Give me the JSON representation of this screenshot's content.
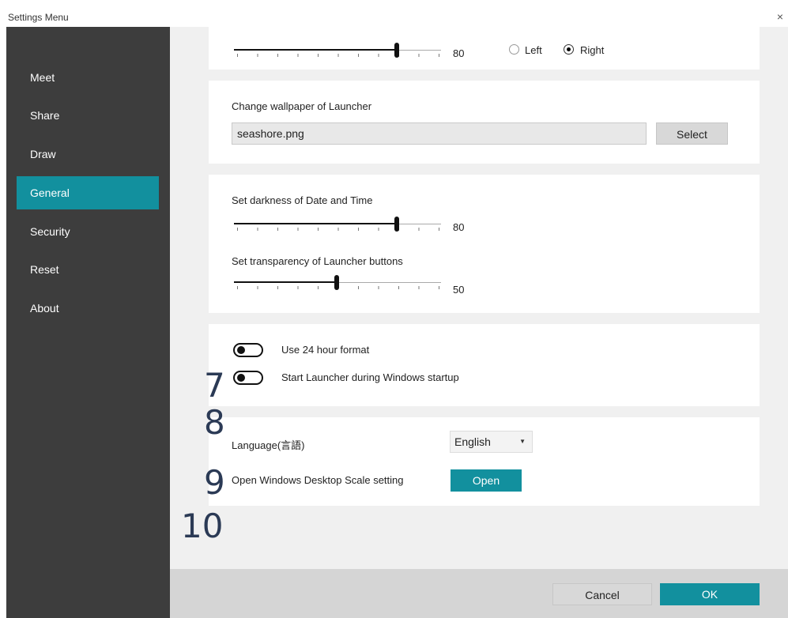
{
  "window": {
    "title": "Settings Menu",
    "close_glyph": "×"
  },
  "sidebar": {
    "items": [
      {
        "label": "Meet"
      },
      {
        "label": "Share"
      },
      {
        "label": "Draw"
      },
      {
        "label": "General",
        "active": true
      },
      {
        "label": "Security"
      },
      {
        "label": "Reset"
      },
      {
        "label": "About"
      }
    ]
  },
  "launcher_position": {
    "slider_value": 80,
    "slider_value_text": "80",
    "options": [
      {
        "label": "Left",
        "selected": false
      },
      {
        "label": "Right",
        "selected": true
      }
    ]
  },
  "wallpaper": {
    "heading": "Change wallpaper of Launcher",
    "file_name": "seashore.png",
    "select_label": "Select"
  },
  "appearance": {
    "darkness_label": "Set darkness of Date and Time",
    "darkness_value": 80,
    "darkness_value_text": "80",
    "transparency_label": "Set transparency of Launcher buttons",
    "transparency_value": 50,
    "transparency_value_text": "50"
  },
  "toggles": {
    "format_24h_label": "Use 24 hour format",
    "format_24h_on": false,
    "startup_label": "Start Launcher during Windows startup",
    "startup_on": false
  },
  "language": {
    "label": "Language(言語)",
    "selected": "English",
    "caret": "▼",
    "scale_label": "Open Windows Desktop Scale setting",
    "open_label": "Open"
  },
  "annotations": [
    "7",
    "8",
    "9",
    "10"
  ],
  "footer": {
    "cancel_label": "Cancel",
    "ok_label": "OK"
  },
  "colors": {
    "accent": "#12909e",
    "sidebar": "#3d3d3d",
    "panel": "#f0f0f0",
    "annotation": "#2b3a55"
  }
}
